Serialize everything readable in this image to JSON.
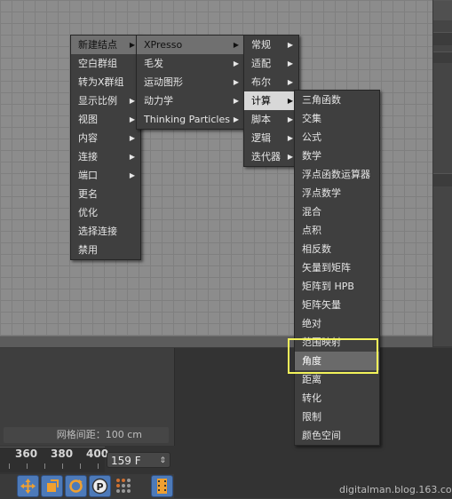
{
  "menus": {
    "root": [
      {
        "label": "新建结点",
        "has_submenu": true,
        "selected": true
      },
      {
        "label": "空白群组",
        "has_submenu": false
      },
      {
        "label": "转为X群组",
        "has_submenu": false
      },
      {
        "label": "显示比例",
        "has_submenu": true
      },
      {
        "label": "视图",
        "has_submenu": true
      },
      {
        "label": "内容",
        "has_submenu": true
      },
      {
        "label": "连接",
        "has_submenu": true
      },
      {
        "label": "端口",
        "has_submenu": true
      },
      {
        "label": "更名",
        "has_submenu": false
      },
      {
        "label": "优化",
        "has_submenu": false
      },
      {
        "label": "选择连接",
        "has_submenu": false
      },
      {
        "label": "禁用",
        "has_submenu": false
      }
    ],
    "new_node": [
      {
        "label": "XPresso",
        "has_submenu": true,
        "selected": true
      },
      {
        "label": "毛发",
        "has_submenu": true
      },
      {
        "label": "运动图形",
        "has_submenu": true
      },
      {
        "label": "动力学",
        "has_submenu": true
      },
      {
        "label": "Thinking Particles",
        "has_submenu": true
      }
    ],
    "xpresso": [
      {
        "label": "常规",
        "has_submenu": true
      },
      {
        "label": "适配",
        "has_submenu": true
      },
      {
        "label": "布尔",
        "has_submenu": true
      },
      {
        "label": "计算",
        "has_submenu": true,
        "selected": true
      },
      {
        "label": "脚本",
        "has_submenu": true
      },
      {
        "label": "逻辑",
        "has_submenu": true
      },
      {
        "label": "迭代器",
        "has_submenu": true
      }
    ],
    "calculate": [
      {
        "label": "三角函数"
      },
      {
        "label": "交集"
      },
      {
        "label": "公式"
      },
      {
        "label": "数学"
      },
      {
        "label": "浮点函数运算器"
      },
      {
        "label": "浮点数学"
      },
      {
        "label": "混合"
      },
      {
        "label": "点积"
      },
      {
        "label": "相反数"
      },
      {
        "label": "矢量到矩阵"
      },
      {
        "label": "矩阵到 HPB"
      },
      {
        "label": "矩阵矢量"
      },
      {
        "label": "绝对"
      },
      {
        "label": "范围映射"
      },
      {
        "label": "角度",
        "highlighted": true
      },
      {
        "label": "距离"
      },
      {
        "label": "转化"
      },
      {
        "label": "限制"
      },
      {
        "label": "颜色空间"
      }
    ]
  },
  "status": {
    "grid_spacing": "网格间距：100 cm",
    "frame_field": "159 F",
    "ruler_ticks": [
      "360",
      "380",
      "400"
    ]
  },
  "watermark": "digitalman.blog.163.com",
  "colors": {
    "menu_bg": "#3f3f3f",
    "menu_selected": "#707070",
    "highlight_outline": "#f3f35a",
    "toolbar_blue": "#4d7ab9"
  }
}
